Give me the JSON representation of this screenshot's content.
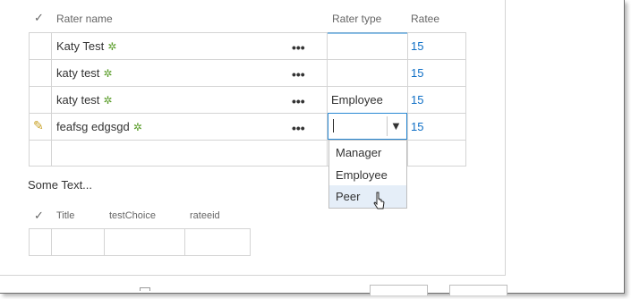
{
  "grid1": {
    "header_check": "✓",
    "col_rater_name": "Rater name",
    "col_rater_type": "Rater type",
    "col_ratee": "Ratee",
    "rows": [
      {
        "name": "Katy Test",
        "type": "",
        "ratee": "15"
      },
      {
        "name": "katy test",
        "type": "",
        "ratee": "15"
      },
      {
        "name": "katy test",
        "type": "Employee",
        "ratee": "15"
      },
      {
        "name": "feafsg edgsgd",
        "type": "",
        "ratee": "15"
      }
    ],
    "ellipsis": "•••",
    "presence_glyph": "✲",
    "edit_glyph": "✎",
    "dropdown_arrow": "▼",
    "dropdown_options": [
      "Manager",
      "Employee",
      "Peer"
    ]
  },
  "section_text": "Some Text...",
  "grid2": {
    "header_check": "✓",
    "col_title": "Title",
    "col_testchoice": "testChoice",
    "col_rateeid": "rateeid"
  },
  "colors": {
    "link": "#0f6fc6",
    "presence": "#5c9e2c",
    "focus_border": "#2a8ad4",
    "hover_option": "#e5eef8",
    "grid_line": "#d4d4d4"
  }
}
